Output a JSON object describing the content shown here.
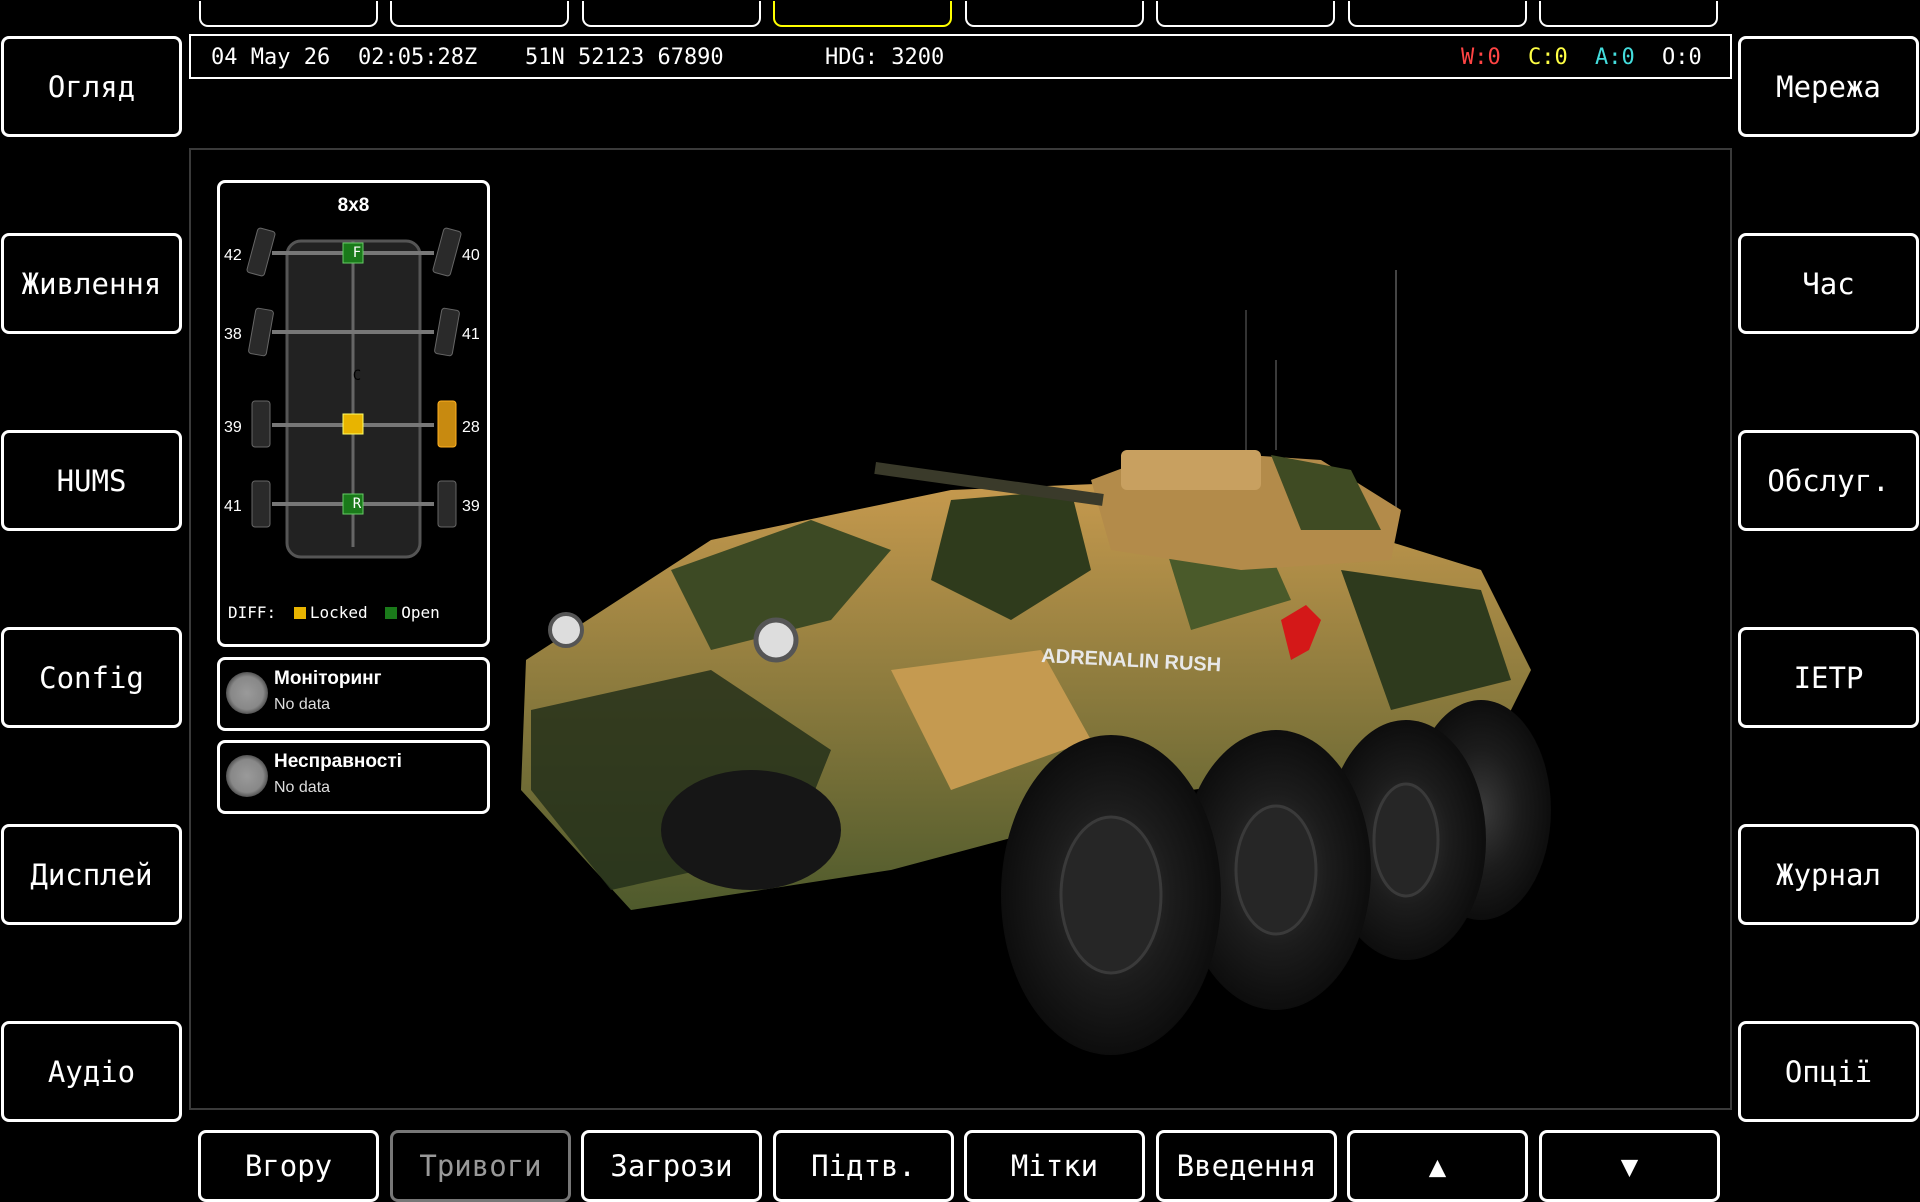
{
  "status": {
    "date": "04 May 26",
    "time": "02:05:28Z",
    "grid": "51N 52123 67890",
    "heading": "HDG: 3200",
    "counts": [
      {
        "label": "W:0",
        "color": "#ff4444"
      },
      {
        "label": "C:0",
        "color": "#ffff44"
      },
      {
        "label": "A:0",
        "color": "#44dddd"
      },
      {
        "label": "O:0",
        "color": "#ffffff"
      }
    ]
  },
  "top_tabs": {
    "active_index": 3
  },
  "left_menu": [
    "Огляд",
    "Живлення",
    "HUMS",
    "Config",
    "Дисплей",
    "Аудіо"
  ],
  "right_menu": [
    "Мережа",
    "Час",
    "Обслуг.",
    "IETP",
    "Журнал",
    "Опції"
  ],
  "bottom_menu": [
    {
      "label": "Вгору",
      "disabled": false
    },
    {
      "label": "Тривоги",
      "disabled": true
    },
    {
      "label": "Загрози",
      "disabled": false
    },
    {
      "label": "Підтв.",
      "disabled": false
    },
    {
      "label": "Мітки",
      "disabled": false
    },
    {
      "label": "Введення",
      "disabled": false
    },
    {
      "label": "▲",
      "disabled": false
    },
    {
      "label": "▼",
      "disabled": false
    }
  ],
  "drive": {
    "title": "8x8",
    "tires": {
      "front_left": "42",
      "front_right": "40",
      "row2_left": "38",
      "row2_right": "41",
      "row3_left": "39",
      "row3_right": "28",
      "rear_left": "41",
      "rear_right": "39"
    },
    "diffs": {
      "front": "F",
      "center": "C",
      "rear": "R"
    },
    "legend": {
      "prefix": "DIFF:",
      "locked": "Locked",
      "open": "Open"
    },
    "colors": {
      "locked": "#e8b400",
      "open": "#1a7a1a",
      "warn_tire": "#c88a10"
    }
  },
  "monitoring": {
    "title": "Моніторинг",
    "value": "No data"
  },
  "faults": {
    "title": "Несправності",
    "value": "No data"
  },
  "vehicle": {
    "marking": "ADRENALIN RUSH"
  }
}
